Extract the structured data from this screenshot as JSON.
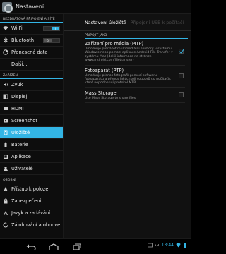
{
  "window": {
    "title": "Nastavení"
  },
  "left": {
    "sections": [
      {
        "header": "BEZDRÁTOVÁ PŘIPOJENÍ A SÍTĚ",
        "items": [
          {
            "label": "Wi-Fi",
            "icon": "wifi-icon",
            "toggle": "I",
            "toggle_on": true
          },
          {
            "label": "Bluetooth",
            "icon": "bluetooth-icon",
            "toggle": "O",
            "toggle_on": false
          },
          {
            "label": "Přenesená data",
            "icon": "data-usage-icon"
          },
          {
            "label": "Další...",
            "icon": ""
          }
        ]
      },
      {
        "header": "ZAŘÍZENÍ",
        "items": [
          {
            "label": "Zvuk",
            "icon": "speaker-icon"
          },
          {
            "label": "Displej",
            "icon": "display-icon"
          },
          {
            "label": "HDMI",
            "icon": "hdmi-icon"
          },
          {
            "label": "Screenshot",
            "icon": "screenshot-icon"
          },
          {
            "label": "Úložiště",
            "icon": "storage-icon",
            "selected": true
          },
          {
            "label": "Baterie",
            "icon": "battery-icon"
          },
          {
            "label": "Aplikace",
            "icon": "apps-icon"
          },
          {
            "label": "Uživatelé",
            "icon": "users-icon"
          }
        ]
      },
      {
        "header": "OSOBNÍ",
        "items": [
          {
            "label": "Přístup k poloze",
            "icon": "location-icon"
          },
          {
            "label": "Zabezpečení",
            "icon": "lock-icon"
          },
          {
            "label": "Jazyk a zadávání",
            "icon": "language-icon"
          },
          {
            "label": "Zálohování a obnove",
            "icon": "backup-icon"
          }
        ]
      }
    ]
  },
  "right": {
    "tabs": {
      "active": "Nastavení úložiště",
      "inactive": "Připojení USB k počítači"
    },
    "section": "PŘIPOJIT JAKO",
    "options": [
      {
        "title": "Zařízení pro média (MTP)",
        "desc": "Umožňuje přenášet multimediální soubory v systému Windows nebo pomocí aplikace Android File Transfer v systému Mac (další informace na stránce www.android.com/filetransfer)",
        "checked": true
      },
      {
        "title": "Fotoaparát (PTP)",
        "desc": "Umožňuje přenos fotografií pomocí softwaru fotoaparátu a přenos jakýchkoli souborů do počítačů, které nepodporují protokol MTP",
        "checked": false
      },
      {
        "title": "Mass Storage",
        "desc": "Use Mass Storage to share files",
        "checked": false
      }
    ]
  },
  "navbar": {
    "time": "13:44"
  },
  "colors": {
    "accent": "#33b5e5",
    "background": "#111111"
  }
}
